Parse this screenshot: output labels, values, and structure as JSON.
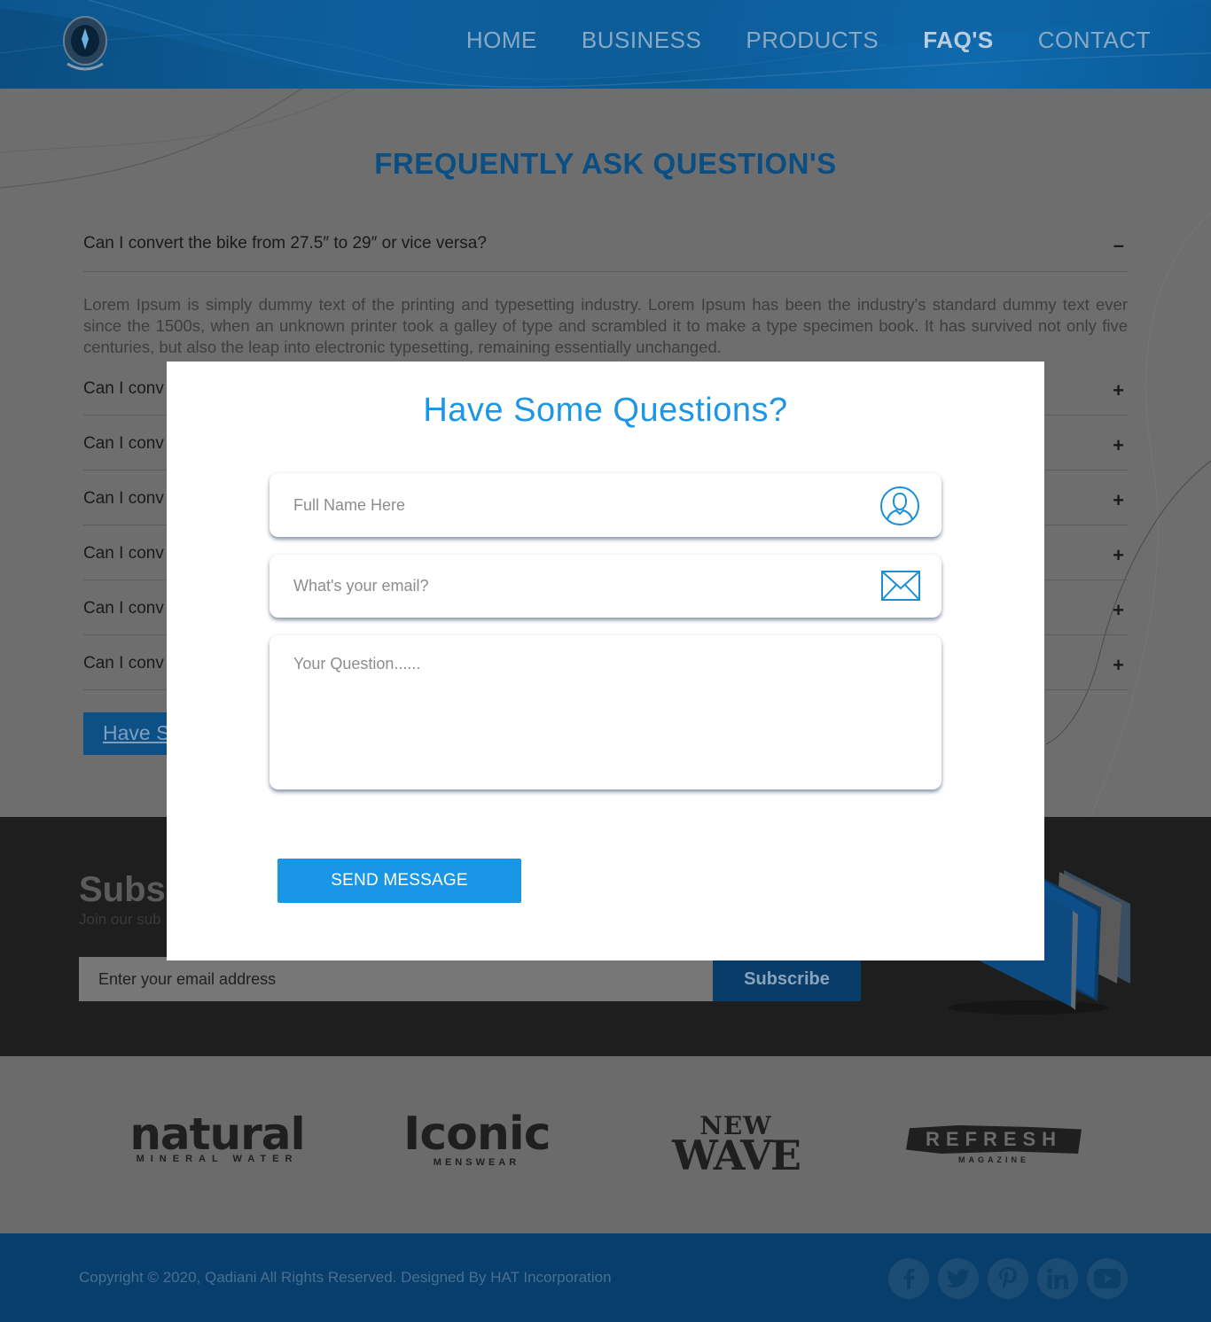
{
  "header": {
    "logo_name": "qadiani-logo",
    "nav": [
      {
        "label": "HOME",
        "active": false
      },
      {
        "label": "BUSINESS",
        "active": false
      },
      {
        "label": "PRODUCTS",
        "active": false
      },
      {
        "label": "FAQ'S",
        "active": true
      },
      {
        "label": "CONTACT",
        "active": false
      }
    ]
  },
  "faq": {
    "title": "FREQUENTLY ASK QUESTION'S",
    "items": [
      {
        "question": "Can I convert the bike from 27.5″ to 29″ or vice versa?",
        "toggle": "–",
        "expanded": true
      },
      {
        "question": "Can I conv",
        "toggle": "+",
        "expanded": false
      },
      {
        "question": "Can I conv",
        "toggle": "+",
        "expanded": false
      },
      {
        "question": "Can I conv",
        "toggle": "+",
        "expanded": false
      },
      {
        "question": "Can I conv",
        "toggle": "+",
        "expanded": false
      },
      {
        "question": "Can I conv",
        "toggle": "+",
        "expanded": false
      },
      {
        "question": "Can I conv",
        "toggle": "+",
        "expanded": false
      }
    ],
    "answer": "Lorem Ipsum is simply dummy text of the printing and typesetting industry. Lorem Ipsum has been the industry's standard dummy text ever since the 1500s, when an unknown printer took a galley of type and scrambled it to make a type specimen book. It has survived not only five centuries, but also the leap into electronic typesetting, remaining essentially unchanged.",
    "have_button_label": "Have S"
  },
  "subscribe": {
    "title": "Subsc",
    "text": "Join our sub",
    "input_placeholder": "Enter your email address",
    "button_label": "Subscribe"
  },
  "brands": {
    "natural": {
      "main": "natural",
      "sub": "MINERAL WATER"
    },
    "iconic": {
      "main": "Iconic",
      "sub": "MENSWEAR"
    },
    "newwave": {
      "top": "NEW",
      "main": "WAVE"
    },
    "refresh": {
      "main": "REFRESH",
      "sub": "MAGAZINE"
    }
  },
  "footer": {
    "copyright": "Copyright © 2020, Qadiani All Rights Reserved. Designed By HAT Incorporation",
    "socials": [
      "facebook-icon",
      "twitter-icon",
      "pinterest-icon",
      "linkedin-icon",
      "youtube-icon"
    ]
  },
  "modal": {
    "title": "Have Some Questions?",
    "name_placeholder": "Full Name Here",
    "email_placeholder": "What's your email?",
    "question_placeholder": "Your Question......",
    "send_label": "SEND MESSAGE"
  },
  "colors": {
    "accent": "#1e95e5",
    "header_blue": "#0d5d98",
    "overlay_gray": "#6e6e6e",
    "footer_blue": "#073e6b"
  }
}
